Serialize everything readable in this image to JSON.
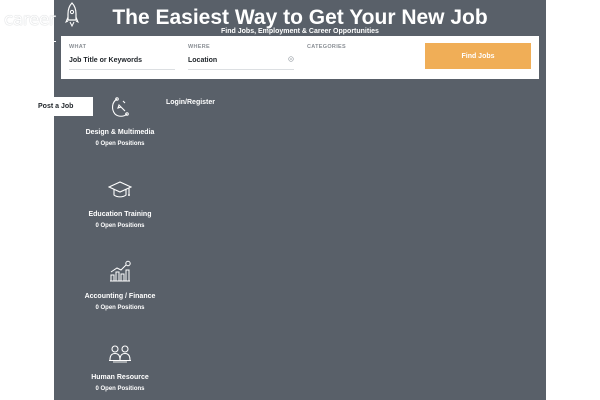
{
  "logo": {
    "text": "career"
  },
  "hero": {
    "title": "The Easiest Way to Get Your New Job",
    "subtitle": "Find Jobs, Employment & Career Opportunities"
  },
  "search": {
    "what_label": "WHAT",
    "what_value": "Job Title or Keywords",
    "where_label": "WHERE",
    "where_value": "Location",
    "categories_label": "CATEGORIES",
    "button_label": "Find Jobs"
  },
  "nav": {
    "post_job_label": "Post a Job",
    "login_label": "Login/Register"
  },
  "categories": [
    {
      "name": "Design & Multimedia",
      "count": "0 Open Positions",
      "icon": "design-tools-icon"
    },
    {
      "name": "Education Training",
      "count": "0 Open Positions",
      "icon": "graduation-cap-icon"
    },
    {
      "name": "Accounting / Finance",
      "count": "0 Open Positions",
      "icon": "finance-chart-icon"
    },
    {
      "name": "Human Resource",
      "count": "0 Open Positions",
      "icon": "people-icon"
    }
  ],
  "colors": {
    "hero_background": "#596069",
    "accent": "#f0ae57",
    "text_light": "#ffffff",
    "text_dark": "#22272c"
  }
}
